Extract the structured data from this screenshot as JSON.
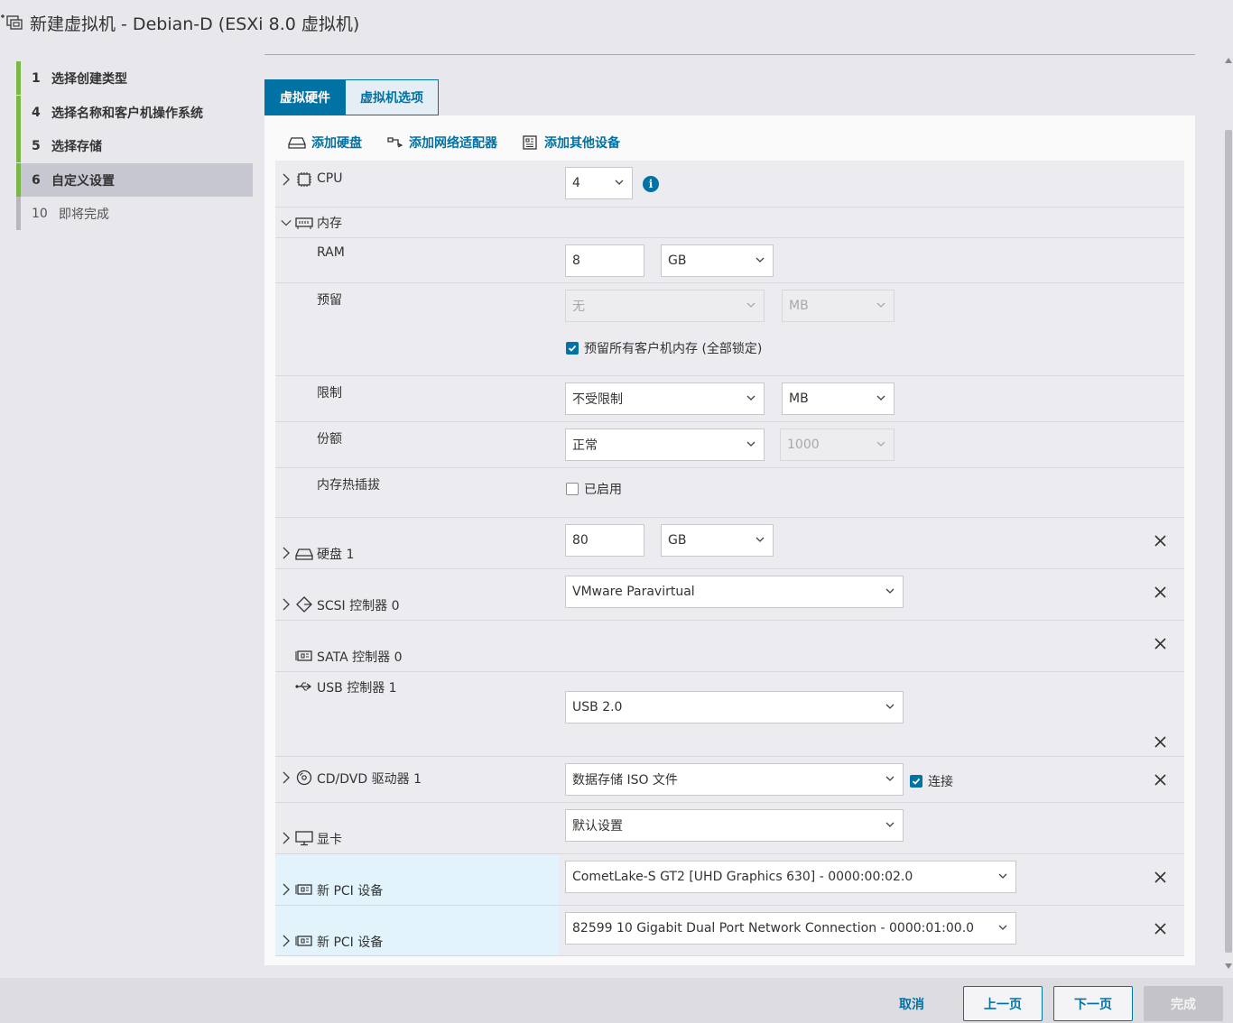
{
  "window": {
    "title": "新建虚拟机 - Debian-D (ESXi 8.0 虚拟机)"
  },
  "nav": {
    "steps": [
      {
        "num": "1",
        "label": "选择创建类型",
        "state": "done"
      },
      {
        "num": "4",
        "label": "选择名称和客户机操作系统",
        "state": "done"
      },
      {
        "num": "5",
        "label": "选择存储",
        "state": "done"
      },
      {
        "num": "6",
        "label": "自定义设置",
        "state": "active"
      },
      {
        "num": "10",
        "label": "即将完成",
        "state": "future"
      }
    ]
  },
  "tabs": {
    "hardware": "虚拟硬件",
    "options": "虚拟机选项"
  },
  "toolbar": {
    "add_disk": "添加硬盘",
    "add_nic": "添加网络适配器",
    "add_other": "添加其他设备"
  },
  "cpu": {
    "label": "CPU",
    "value": "4"
  },
  "memory": {
    "label": "内存",
    "ram_label": "RAM",
    "ram_value": "8",
    "ram_unit": "GB",
    "reservation_label": "预留",
    "reservation_value": "无",
    "reservation_unit": "MB",
    "reserve_all_label": "预留所有客户机内存 (全部锁定)",
    "reserve_all_checked": true,
    "limit_label": "限制",
    "limit_value": "不受限制",
    "limit_unit": "MB",
    "shares_label": "份额",
    "shares_value": "正常",
    "shares_number": "1000",
    "hotplug_label": "内存热插拔",
    "hotplug_option": "已启用",
    "hotplug_checked": false
  },
  "disk1": {
    "label": "硬盘 1",
    "size": "80",
    "unit": "GB"
  },
  "scsi": {
    "label": "SCSI 控制器 0",
    "value": "VMware Paravirtual"
  },
  "sata": {
    "label": "SATA 控制器 0"
  },
  "usb": {
    "label": "USB 控制器 1",
    "value": "USB 2.0"
  },
  "cdrom": {
    "label": "CD/DVD 驱动器 1",
    "value": "数据存储 ISO 文件",
    "connect_label": "连接",
    "connect_checked": true
  },
  "video": {
    "label": "显卡",
    "value": "默认设置"
  },
  "pci1": {
    "label": "新 PCI 设备",
    "value": "CometLake-S GT2 [UHD Graphics 630] - 0000:00:02.0"
  },
  "pci2": {
    "label": "新 PCI 设备",
    "value": "82599 10 Gigabit Dual Port Network Connection - 0000:01:00.0"
  },
  "footer": {
    "cancel": "取消",
    "back": "上一页",
    "next": "下一页",
    "finish": "完成"
  },
  "colors": {
    "accent": "#0072a3",
    "step_done": "#7ab648",
    "pci_row": "#e2f3fb"
  }
}
